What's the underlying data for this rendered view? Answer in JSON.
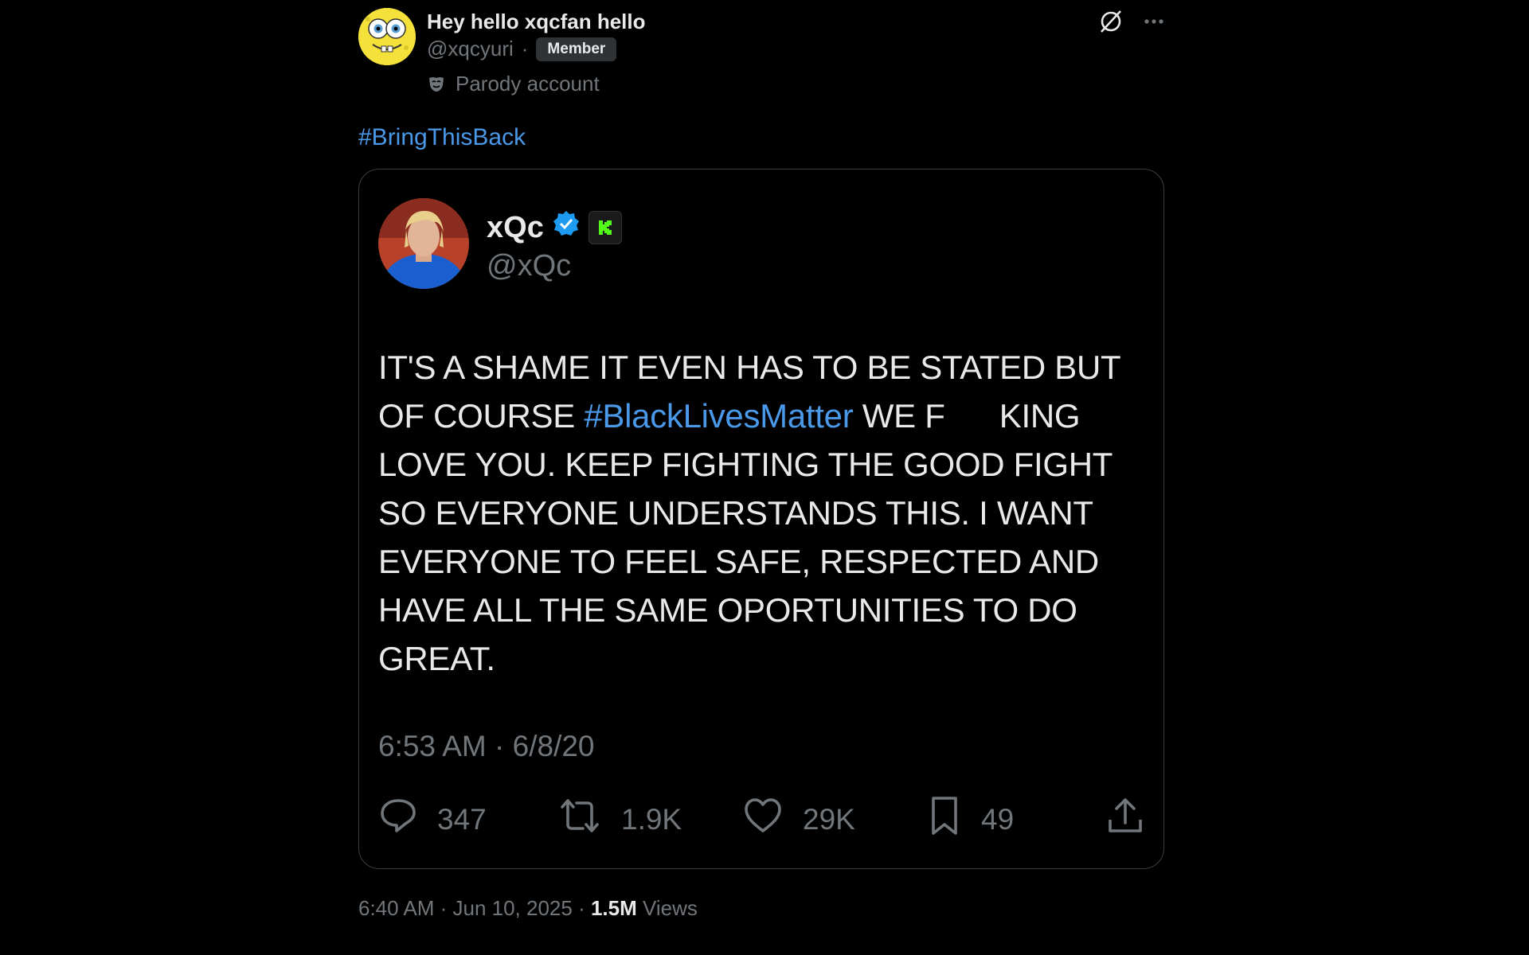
{
  "tweet": {
    "author": {
      "display_name": "Hey hello xqcfan hello",
      "handle": "@xqcyuri",
      "separator": "·",
      "badge": "Member",
      "parody_label": "Parody account"
    },
    "hashtag": "#BringThisBack",
    "quoted": {
      "display_name": "xQc",
      "handle": "@xQc",
      "text_before": "IT'S A SHAME IT EVEN HAS TO BE STATED BUT OF COURSE ",
      "text_tag": "#BlackLivesMatter",
      "text_after": " WE F      KING LOVE YOU. KEEP FIGHTING THE GOOD FIGHT SO EVERYONE UNDERSTANDS THIS. I WANT EVERYONE TO FEEL SAFE, RESPECTED AND HAVE ALL THE SAME OPORTUNITIES TO DO GREAT.",
      "timestamp": "6:53 AM · 6/8/20",
      "replies": "347",
      "retweets": "1.9K",
      "likes": "29K",
      "bookmarks": "49"
    },
    "meta": {
      "time": "6:40 AM · Jun 10, 2025 · ",
      "views_count": "1.5M",
      "views_label": " Views"
    }
  },
  "colors": {
    "background": "#000000",
    "accent": "#4a99e9",
    "muted": "#71767b",
    "verified": "#1d9bf0",
    "kick_green": "#53fc18"
  },
  "icons": [
    "grok-icon",
    "more-icon",
    "parody-mask-icon",
    "verified-icon",
    "kick-icon",
    "reply-icon",
    "retweet-icon",
    "like-icon",
    "bookmark-icon",
    "share-icon"
  ]
}
